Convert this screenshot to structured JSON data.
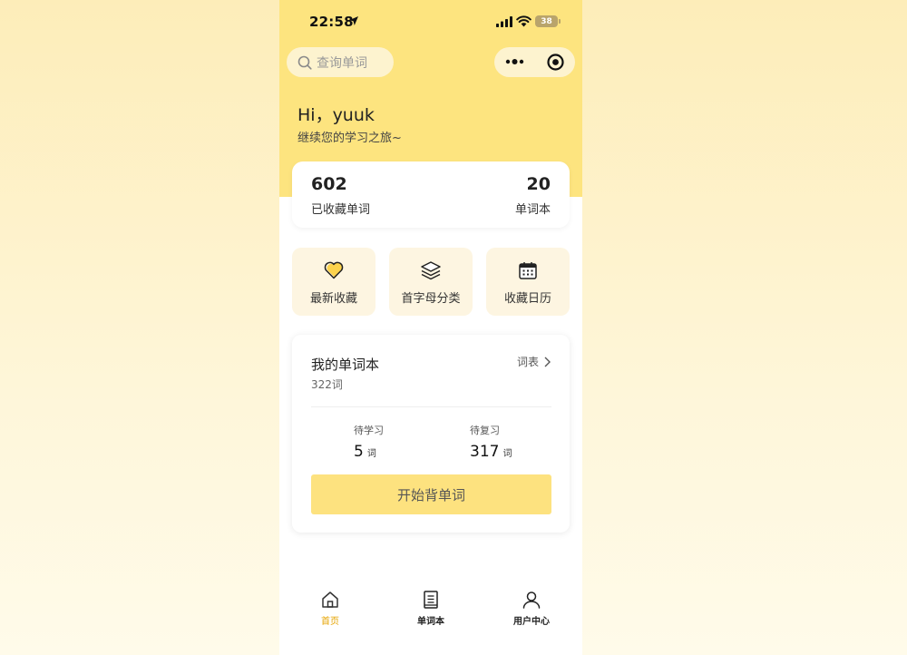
{
  "status_bar": {
    "time": "22:58",
    "battery": "38"
  },
  "search": {
    "placeholder": "查询单词"
  },
  "greeting": {
    "hello": "Hi，yuuk",
    "subtitle": "继续您的学习之旅~"
  },
  "stats": {
    "saved_words": {
      "value": "602",
      "label": "已收藏单词"
    },
    "wordbooks": {
      "value": "20",
      "label": "单词本"
    }
  },
  "quick_actions": [
    {
      "label": "最新收藏",
      "icon": "heart-icon"
    },
    {
      "label": "首字母分类",
      "icon": "layers-icon"
    },
    {
      "label": "收藏日历",
      "icon": "calendar-icon"
    }
  ],
  "wordbook": {
    "title": "我的单词本",
    "count": "322词",
    "link_label": "词表",
    "to_learn": {
      "label": "待学习",
      "value": "5",
      "unit": "词"
    },
    "to_review": {
      "label": "待复习",
      "value": "317",
      "unit": "词"
    },
    "start_label": "开始背单词"
  },
  "tab_bar": [
    {
      "label": "首页",
      "icon": "home-icon",
      "active": true
    },
    {
      "label": "单词本",
      "icon": "notebook-icon",
      "active": false
    },
    {
      "label": "用户中心",
      "icon": "user-icon",
      "active": false
    }
  ],
  "colors": {
    "accent": "#fde47f",
    "active_tab": "#e6a400",
    "tile_bg": "#fdf5e1"
  }
}
